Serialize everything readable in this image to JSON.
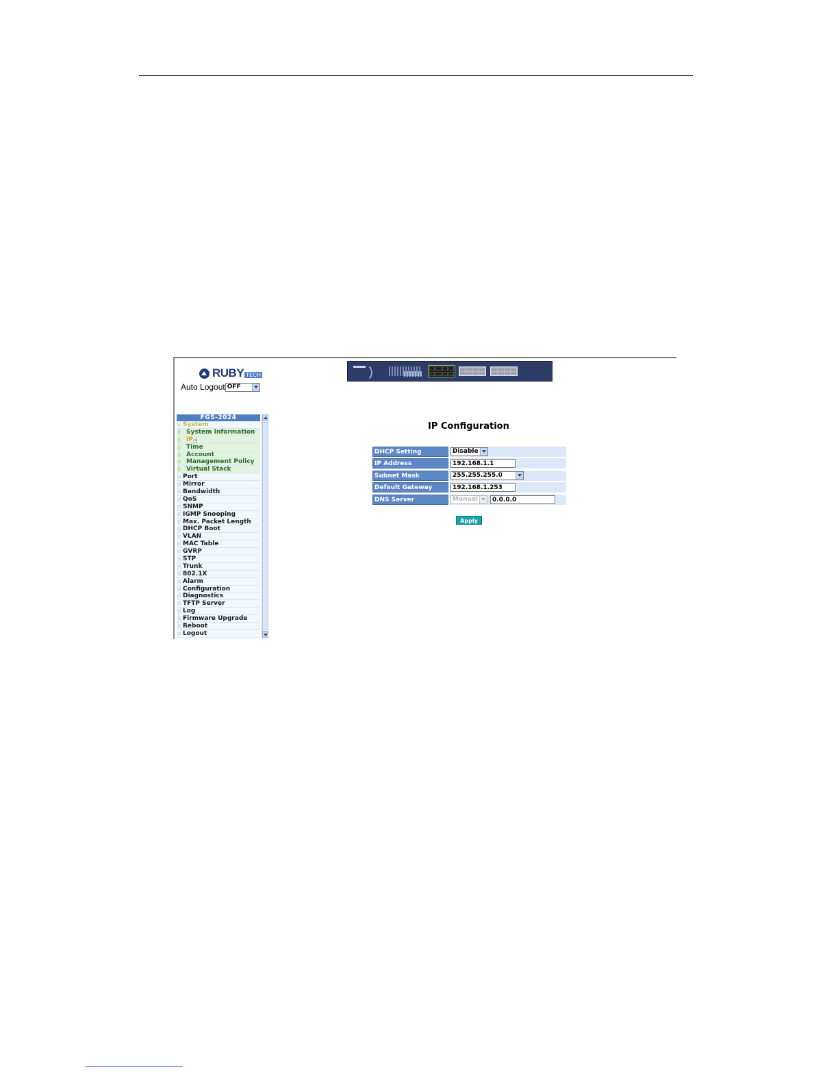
{
  "header": {
    "logo_text": "RUBY",
    "logo_sub": "TECH"
  },
  "auto_logout": {
    "label": "Auto Logout",
    "value": "OFF"
  },
  "sidebar": {
    "heading": "FGS-2024",
    "system": "System",
    "system_items": [
      "System Information",
      "IP",
      "Time",
      "Account",
      "Management Policy",
      "Virtual Stack"
    ],
    "items": [
      "Port",
      "Mirror",
      "Bandwidth",
      "QoS",
      "SNMP",
      "IGMP Snooping",
      "Max. Packet Length",
      "DHCP Boot",
      "VLAN",
      "MAC Table",
      "GVRP",
      "STP",
      "Trunk",
      "802.1X",
      "Alarm",
      "Configuration",
      "Diagnostics",
      "TFTP Server",
      "Log",
      "Firmware Upgrade",
      "Reboot",
      "Logout"
    ]
  },
  "main": {
    "title": "IP Configuration",
    "dhcp": {
      "label": "DHCP Setting",
      "value": "Disable"
    },
    "ip": {
      "label": "IP Address",
      "value": "192.168.1.1"
    },
    "mask": {
      "label": "Subnet Mask",
      "value": "255.255.255.0"
    },
    "gateway": {
      "label": "Default Gateway",
      "value": "192.168.1.253"
    },
    "dns": {
      "label": "DNS Server",
      "mode": "Manual",
      "value": "0.0.0.0"
    },
    "apply_label": "Apply"
  },
  "colors": {
    "label_bg": "#5d87c4",
    "value_bg": "#dbe8f9",
    "apply_bg": "#1aa4a8",
    "sidebar_head": "#4e7fc0"
  }
}
